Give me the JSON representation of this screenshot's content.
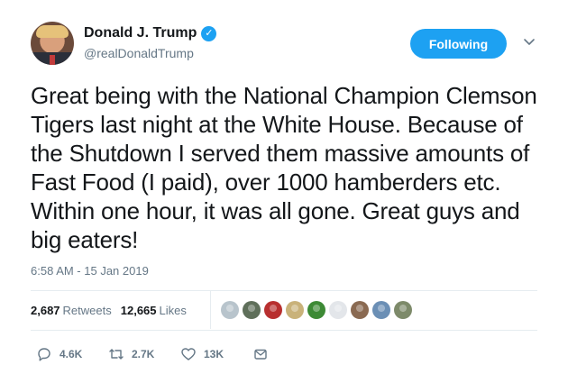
{
  "user": {
    "name": "Donald J. Trump",
    "handle": "@realDonaldTrump",
    "verified_icon": "verified-badge-icon",
    "verified_glyph": "✓"
  },
  "follow_button": {
    "label": "Following"
  },
  "menu": {
    "icon": "chevron-down-icon",
    "glyph": "⌄"
  },
  "tweet": {
    "text": "Great being with the National Champion Clemson Tigers last night at the White House. Because of the Shutdown I served them massive amounts of Fast Food (I paid), over 1000 hamberders etc. Within one hour, it was all gone. Great guys and big eaters!",
    "timestamp": "6:58 AM - 15 Jan 2019"
  },
  "stats": {
    "retweets_count": "2,687",
    "retweets_label": "Retweets",
    "likes_count": "12,665",
    "likes_label": "Likes"
  },
  "likers": [
    {
      "color": "#b8c4cc"
    },
    {
      "color": "#5f6f5a"
    },
    {
      "color": "#b83030"
    },
    {
      "color": "#c9b27a"
    },
    {
      "color": "#3d8a35"
    },
    {
      "color": "#e3e6ea"
    },
    {
      "color": "#8a6a52"
    },
    {
      "color": "#6b8fb5"
    },
    {
      "color": "#7d8a6a"
    }
  ],
  "actions": {
    "reply_count": "4.6K",
    "retweet_count": "2.7K",
    "like_count": "13K"
  },
  "colors": {
    "accent": "#1da1f2",
    "secondary_text": "#657786",
    "primary_text": "#14171a",
    "divider": "#e6ecf0"
  }
}
